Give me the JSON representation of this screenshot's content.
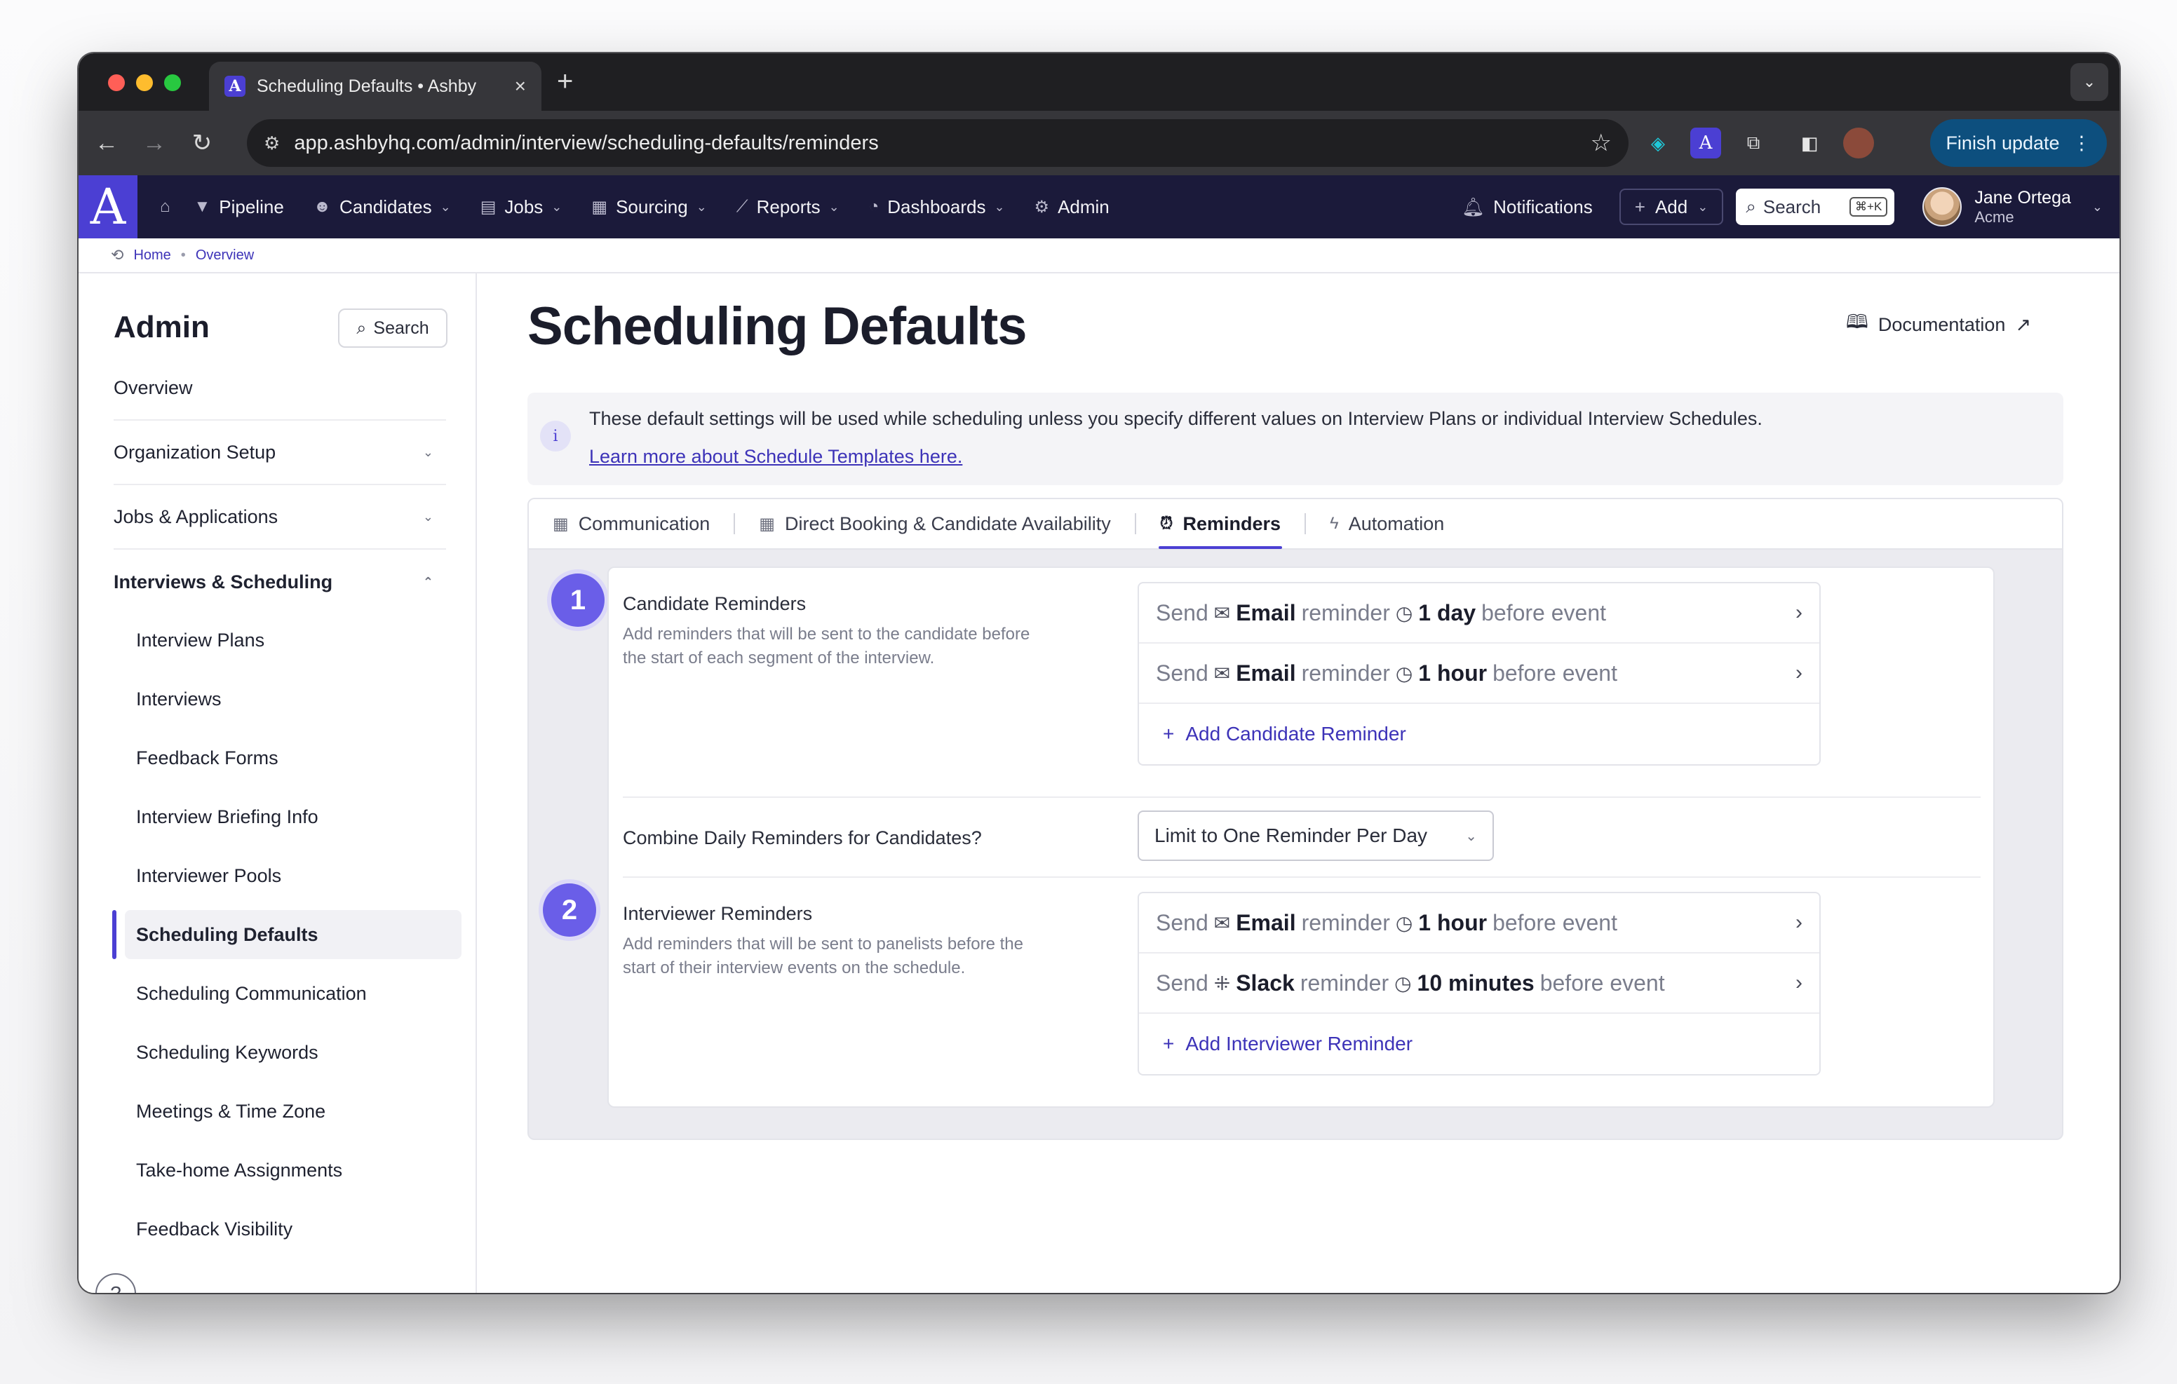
{
  "browser": {
    "tab_title": "Scheduling Defaults • Ashby",
    "tab_favicon": "A",
    "url": "app.ashbyhq.com/admin/interview/scheduling-defaults/reminders",
    "finish_update": "Finish update"
  },
  "appnav": {
    "logo": "A",
    "items": [
      {
        "label": "Pipeline",
        "icon": "filter-icon"
      },
      {
        "label": "Candidates",
        "icon": "people-icon"
      },
      {
        "label": "Jobs",
        "icon": "briefcase-icon"
      },
      {
        "label": "Sourcing",
        "icon": "sourcing-icon"
      },
      {
        "label": "Reports",
        "icon": "chart-icon"
      },
      {
        "label": "Dashboards",
        "icon": "gauge-icon"
      },
      {
        "label": "Admin",
        "icon": "gear-icon"
      }
    ],
    "notifications": "Notifications",
    "add": "Add",
    "search": "Search",
    "search_shortcut": "⌘+K",
    "user_name": "Jane Ortega",
    "user_org": "Acme"
  },
  "breadcrumb": {
    "home": "Home",
    "separator": "•",
    "current": "Overview"
  },
  "sidebar": {
    "title": "Admin",
    "search": "Search",
    "sections": [
      "Overview",
      "Organization Setup",
      "Jobs & Applications",
      "Interviews & Scheduling"
    ],
    "sub_items": [
      "Interview Plans",
      "Interviews",
      "Feedback Forms",
      "Interview Briefing Info",
      "Interviewer Pools",
      "Scheduling Defaults",
      "Scheduling Communication",
      "Scheduling Keywords",
      "Meetings & Time Zone",
      "Take-home Assignments",
      "Feedback Visibility"
    ],
    "active_sub": "Scheduling Defaults",
    "help": "?"
  },
  "main": {
    "title": "Scheduling Defaults",
    "documentation": "Documentation",
    "info": {
      "text": "These default settings will be used while scheduling unless you specify different values on Interview Plans or individual Interview Schedules.",
      "link": "Learn more about Schedule Templates here."
    },
    "tabs": [
      {
        "label": "Communication",
        "icon": "calendar-icon"
      },
      {
        "label": "Direct Booking & Candidate Availability",
        "icon": "calendar-icon"
      },
      {
        "label": "Reminders",
        "icon": "alarm-icon",
        "active": true
      },
      {
        "label": "Automation",
        "icon": "bolt-icon"
      }
    ],
    "candidate": {
      "step": "1",
      "title": "Candidate Reminders",
      "description": "Add reminders that will be sent to the candidate before the start of each segment of the interview.",
      "reminders": [
        {
          "send": "Send",
          "channel": "Email",
          "word": "reminder",
          "time": "1 day",
          "suffix": "before event",
          "channel_icon": "mail-icon"
        },
        {
          "send": "Send",
          "channel": "Email",
          "word": "reminder",
          "time": "1 hour",
          "suffix": "before event",
          "channel_icon": "mail-icon"
        }
      ],
      "add": "Add Candidate Reminder"
    },
    "combine": {
      "label": "Combine Daily Reminders for Candidates?",
      "value": "Limit to One Reminder Per Day"
    },
    "interviewer": {
      "step": "2",
      "title": "Interviewer Reminders",
      "description": "Add reminders that will be sent to panelists before the start of their interview events on the schedule.",
      "reminders": [
        {
          "send": "Send",
          "channel": "Email",
          "word": "reminder",
          "time": "1 hour",
          "suffix": "before event",
          "channel_icon": "mail-icon"
        },
        {
          "send": "Send",
          "channel": "Slack",
          "word": "reminder",
          "time": "10 minutes",
          "suffix": "before event",
          "channel_icon": "slack-icon"
        }
      ],
      "add": "Add Interviewer Reminder"
    }
  }
}
